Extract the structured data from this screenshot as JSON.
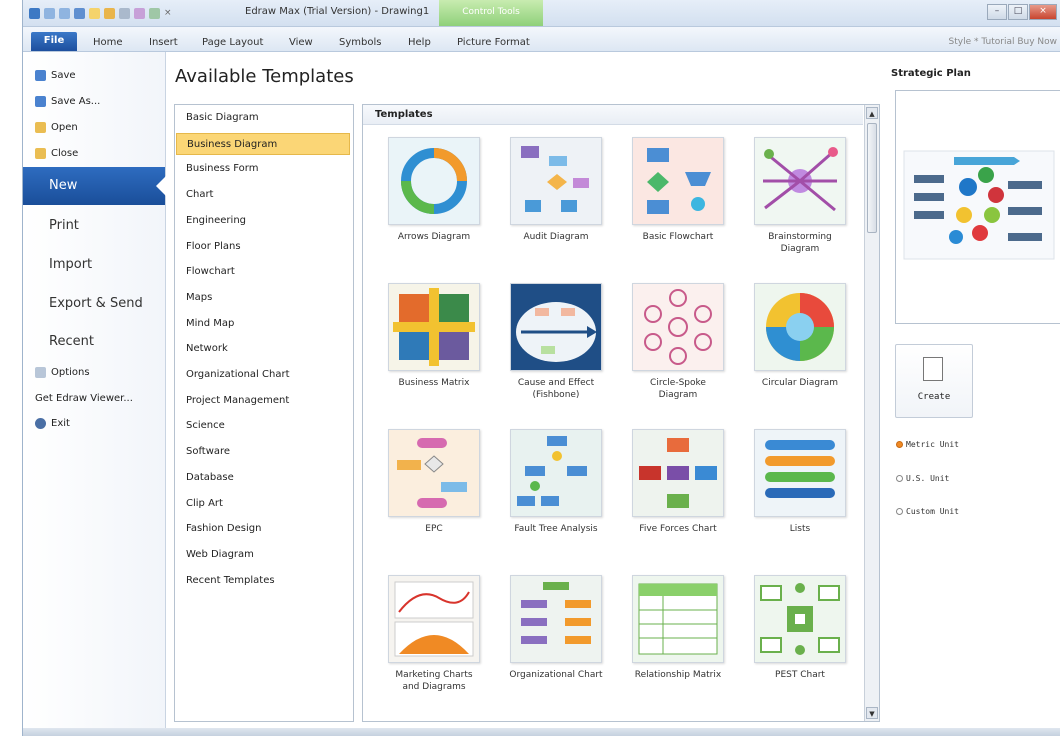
{
  "window": {
    "title": "Edraw Max (Trial Version) - Drawing1",
    "context_tab": "Control Tools",
    "minimize": "–",
    "maximize": "□",
    "close": "×"
  },
  "ribbon": {
    "file": "File",
    "tabs": [
      "Home",
      "Insert",
      "Page Layout",
      "View",
      "Symbols",
      "Help",
      "Picture Format"
    ],
    "right": "Style  * Tutorial  Buy Now"
  },
  "backstage": {
    "save": "Save",
    "save_as": "Save As...",
    "open": "Open",
    "close": "Close",
    "new": "New",
    "print": "Print",
    "import": "Import",
    "export": "Export & Send",
    "recent": "Recent",
    "options": "Options",
    "viewer": "Get Edraw Viewer...",
    "exit": "Exit"
  },
  "heading": "Available Templates",
  "categories": [
    "Basic Diagram",
    "Business Diagram",
    "Business Form",
    "Chart",
    "Engineering",
    "Floor Plans",
    "Flowchart",
    "Maps",
    "Mind Map",
    "Network",
    "Organizational Chart",
    "Project Management",
    "Science",
    "Software",
    "Database",
    "Clip Art",
    "Fashion Design",
    "Web Diagram",
    "Recent Templates"
  ],
  "selected_category": "Business Diagram",
  "templates_header": "Templates",
  "templates": [
    "Arrows Diagram",
    "Audit Diagram",
    "Basic Flowchart",
    "Brainstorming\nDiagram",
    "Business Matrix",
    "Cause and Effect\n(Fishbone)",
    "Circle-Spoke\nDiagram",
    "Circular Diagram",
    "EPC",
    "Fault Tree Analysis",
    "Five Forces Chart",
    "Lists",
    "Marketing Charts\nand Diagrams",
    "Organizational Chart",
    "Relationship Matrix",
    "PEST Chart"
  ],
  "preview": {
    "title": "Strategic Plan",
    "create": "Create"
  },
  "units": {
    "metric": "Metric Unit",
    "us": "U.S. Unit",
    "custom": "Custom Unit",
    "selected": "Metric Unit"
  },
  "colors": {
    "accent": "#1d4f9e",
    "selection": "#fbd676",
    "context_tab": "#8fd07a"
  }
}
